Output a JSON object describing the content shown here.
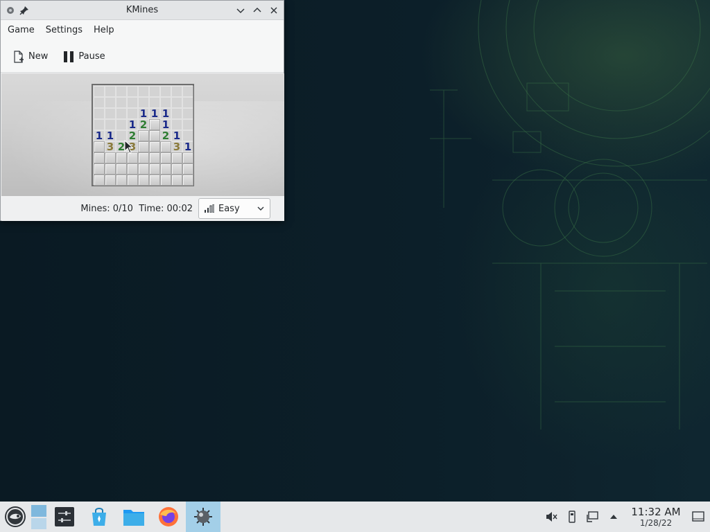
{
  "window": {
    "title": "KMines",
    "menu": [
      "Game",
      "Settings",
      "Help"
    ],
    "toolbar": {
      "new_label": "New",
      "pause_label": "Pause"
    },
    "status": {
      "mines_time": "Mines: 0/10  Time: 00:02",
      "difficulty": "Easy"
    }
  },
  "board": {
    "rows": [
      [
        "",
        "",
        "",
        "",
        "",
        "",
        "",
        "",
        ""
      ],
      [
        "",
        "",
        "",
        "",
        "",
        "",
        "",
        "",
        ""
      ],
      [
        "",
        "",
        "",
        "",
        "1",
        "1",
        "1",
        "",
        ""
      ],
      [
        "",
        "",
        "",
        "1",
        "2",
        "#",
        "1",
        "",
        ""
      ],
      [
        "1",
        "1",
        "",
        "2",
        "#",
        "#",
        "2",
        "1",
        ""
      ],
      [
        "#",
        "3",
        "2",
        "3",
        "#",
        "#",
        "#",
        "3",
        "1"
      ],
      [
        "#",
        "#",
        "#",
        "#",
        "#",
        "#",
        "#",
        "#",
        "#"
      ],
      [
        "#",
        "#",
        "#",
        "#",
        "#",
        "#",
        "#",
        "#",
        "#"
      ],
      [
        "#",
        "#",
        "#",
        "#",
        "#",
        "#",
        "#",
        "#",
        "#"
      ]
    ]
  },
  "taskbar": {
    "clock_time": "11:32 AM",
    "clock_date": "1/28/22"
  },
  "colors": {
    "accent": "#3daee9",
    "taskbar": "#e6e8ea",
    "number1": "#1a2a8a",
    "number2": "#2e7d32",
    "number3": "#8a7a3a"
  }
}
